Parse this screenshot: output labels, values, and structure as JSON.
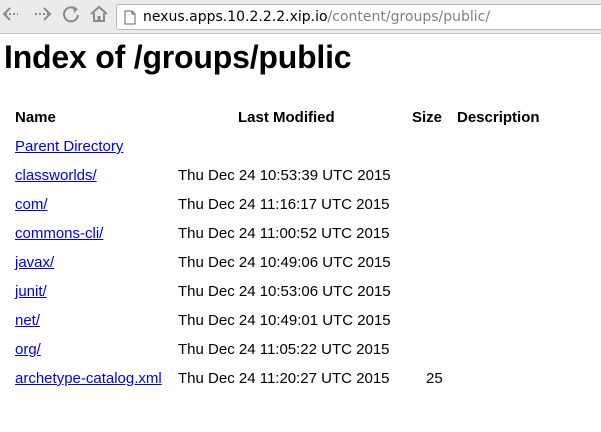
{
  "browser": {
    "url_host": "nexus.apps.10.2.2.2.xip.io",
    "url_path": "/content/groups/public/"
  },
  "page": {
    "title": "Index of /groups/public",
    "headers": {
      "name": "Name",
      "last_modified": "Last Modified",
      "size": "Size",
      "description": "Description"
    },
    "parent_label": "Parent Directory",
    "rows": [
      {
        "name": "classworlds/",
        "modified": "Thu Dec 24 10:53:39 UTC 2015",
        "size": "",
        "description": ""
      },
      {
        "name": "com/",
        "modified": "Thu Dec 24 11:16:17 UTC 2015",
        "size": "",
        "description": ""
      },
      {
        "name": "commons-cli/",
        "modified": "Thu Dec 24 11:00:52 UTC 2015",
        "size": "",
        "description": ""
      },
      {
        "name": "javax/",
        "modified": "Thu Dec 24 10:49:06 UTC 2015",
        "size": "",
        "description": ""
      },
      {
        "name": "junit/",
        "modified": "Thu Dec 24 10:53:06 UTC 2015",
        "size": "",
        "description": ""
      },
      {
        "name": "net/",
        "modified": "Thu Dec 24 10:49:01 UTC 2015",
        "size": "",
        "description": ""
      },
      {
        "name": "org/",
        "modified": "Thu Dec 24 11:05:22 UTC 2015",
        "size": "",
        "description": ""
      },
      {
        "name": "archetype-catalog.xml",
        "modified": "Thu Dec 24 11:20:27 UTC 2015",
        "size": "25",
        "description": ""
      }
    ]
  }
}
